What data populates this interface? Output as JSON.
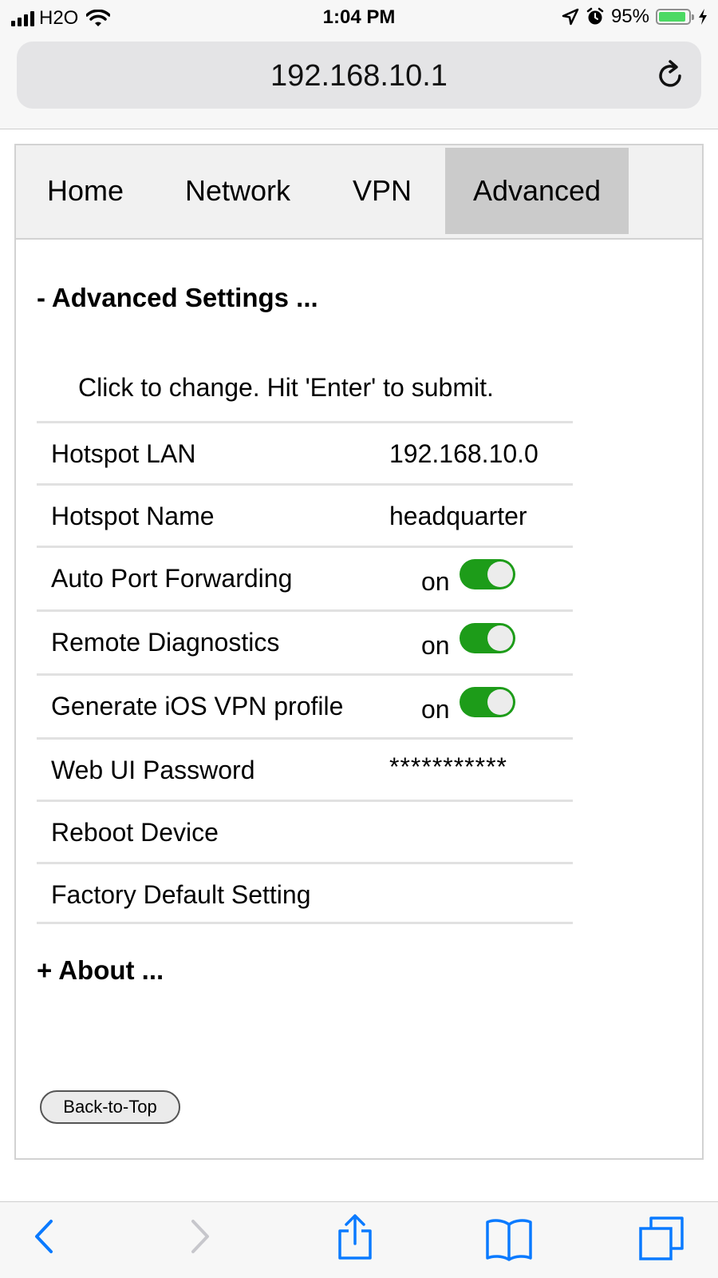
{
  "status_bar": {
    "carrier": "H2O",
    "time": "1:04 PM",
    "battery_percent": "95%",
    "icons": [
      "signal-icon",
      "wifi-icon",
      "location-icon",
      "alarm-icon",
      "battery-icon",
      "charging-icon"
    ]
  },
  "browser": {
    "url": "192.168.10.1",
    "reload_icon": "reload-icon",
    "toolbar_icons": [
      "back-icon",
      "forward-icon",
      "share-icon",
      "bookmarks-icon",
      "tabs-icon"
    ],
    "accent_color": "#0a7aff"
  },
  "nav": {
    "tabs": [
      {
        "label": "Home"
      },
      {
        "label": "Network"
      },
      {
        "label": "VPN"
      },
      {
        "label": "Advanced"
      }
    ],
    "active_tab": "Advanced"
  },
  "advanced": {
    "header": "- Advanced Settings ...",
    "hint": "Click to change. Hit 'Enter' to submit.",
    "rows": [
      {
        "label": "Hotspot LAN",
        "value": "192.168.10.0"
      },
      {
        "label": "Hotspot Name",
        "value": "headquarter"
      },
      {
        "label": "Auto Port Forwarding",
        "value": "on",
        "toggle": true
      },
      {
        "label": "Remote Diagnostics",
        "value": "on",
        "toggle": true
      },
      {
        "label": "Generate iOS VPN profile",
        "value": "on",
        "toggle": true
      },
      {
        "label": "Web UI Password",
        "value": "***********"
      },
      {
        "label": "Reboot Device",
        "value": ""
      },
      {
        "label": "Factory Default Setting",
        "value": ""
      }
    ],
    "toggle_color": "#1d9c19"
  },
  "about": {
    "header": "+ About ..."
  },
  "back_to_top": "Back-to-Top"
}
